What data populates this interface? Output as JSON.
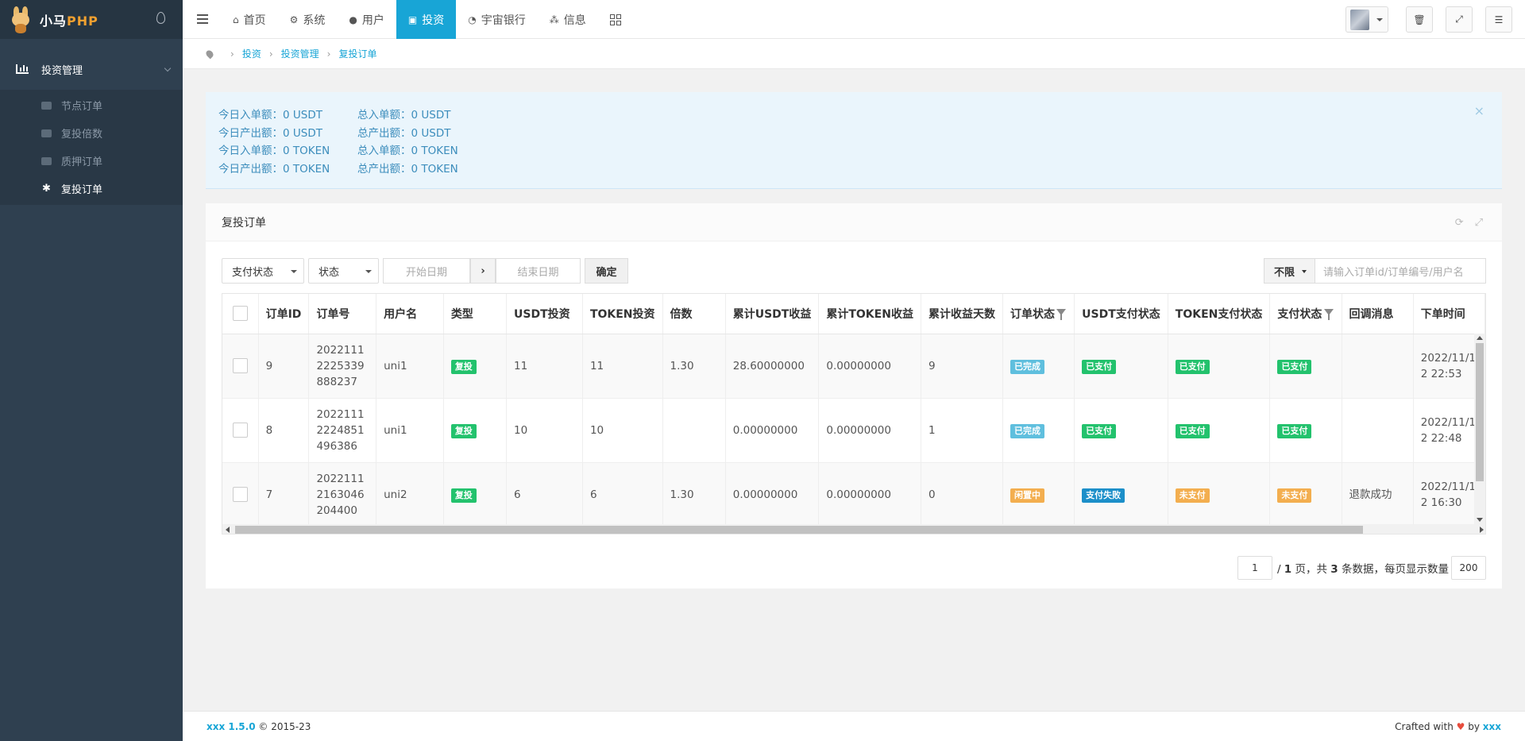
{
  "app": {
    "logo_cn": "小马",
    "logo_php": "PHP"
  },
  "sidebar": {
    "group_label": "投资管理",
    "items": [
      {
        "label": "节点订单",
        "icon": "cloud-icon"
      },
      {
        "label": "复投倍数",
        "icon": "file-icon"
      },
      {
        "label": "质押订单",
        "icon": "list-icon"
      },
      {
        "label": "复投订单",
        "icon": "asterisk-icon",
        "active": true
      }
    ]
  },
  "topnav": [
    {
      "label": "首页",
      "icon": "home-icon",
      "glyph": "⌂"
    },
    {
      "label": "系统",
      "icon": "gear-icon",
      "glyph": "⚙"
    },
    {
      "label": "用户",
      "icon": "user-icon",
      "glyph": "●"
    },
    {
      "label": "投资",
      "icon": "bag-icon",
      "glyph": "▣",
      "active": true
    },
    {
      "label": "宇宙银行",
      "icon": "dashboard-icon",
      "glyph": "◔"
    },
    {
      "label": "信息",
      "icon": "network-icon",
      "glyph": "⁂"
    }
  ],
  "breadcrumb": [
    "投资",
    "投资管理",
    "复投订单"
  ],
  "alert": {
    "rows": [
      [
        "今日入单额：0 USDT",
        "总入单额：0 USDT"
      ],
      [
        "今日产出额：0 USDT",
        "总产出额：0 USDT"
      ],
      [
        "今日入单额：0 TOKEN",
        "总入单额：0 TOKEN"
      ],
      [
        "今日产出额：0 TOKEN",
        "总产出额：0 TOKEN"
      ]
    ],
    "close": "×"
  },
  "panel": {
    "title": "复投订单",
    "toolbar": {
      "pay_status": "支付状态",
      "status": "状态",
      "start_date": "开始日期",
      "end_date": "结束日期",
      "arrow": "›",
      "confirm": "确定",
      "limit": "不限",
      "search_placeholder": "请输入订单id/订单编号/用户名"
    }
  },
  "table": {
    "columns": [
      "",
      "订单ID",
      "订单号",
      "用户名",
      "类型",
      "USDT投资",
      "TOKEN投资",
      "倍数",
      "累计USDT收益",
      "累计TOKEN收益",
      "累计收益天数",
      "订单状态",
      "USDT支付状态",
      "TOKEN支付状态",
      "支付状态",
      "回调消息",
      "下单时间"
    ],
    "rows": [
      {
        "id": "9",
        "order_no": "20221112225339888237",
        "user": "uni1",
        "type": "复投",
        "usdt": "11",
        "token": "11",
        "multiple": "1.30",
        "usdt_income": "28.60000000",
        "token_income": "0.00000000",
        "days": "9",
        "order_status": "已完成",
        "usdt_pay": "已支付",
        "token_pay": "已支付",
        "pay": "已支付",
        "callback": "",
        "time": "2022/11/12 22:53"
      },
      {
        "id": "8",
        "order_no": "20221112224851496386",
        "user": "uni1",
        "type": "复投",
        "usdt": "10",
        "token": "10",
        "multiple": "",
        "usdt_income": "0.00000000",
        "token_income": "0.00000000",
        "days": "1",
        "order_status": "已完成",
        "usdt_pay": "已支付",
        "token_pay": "已支付",
        "pay": "已支付",
        "callback": "",
        "time": "2022/11/12 22:48"
      },
      {
        "id": "7",
        "order_no": "20221112163046204400",
        "user": "uni2",
        "type": "复投",
        "usdt": "6",
        "token": "6",
        "multiple": "1.30",
        "usdt_income": "0.00000000",
        "token_income": "0.00000000",
        "days": "0",
        "order_status": "闲置中",
        "usdt_pay": "支付失败",
        "token_pay": "未支付",
        "pay": "未支付",
        "callback": "退款成功",
        "time": "2022/11/12 16:30"
      }
    ]
  },
  "pager": {
    "page": "1",
    "text_pre": "/ ",
    "total_pages": "1",
    "text_mid": " 页，共 ",
    "total": "3",
    "text_post": " 条数据，每页显示数量",
    "per_page": "200"
  },
  "footer": {
    "brand": "xxx 1.5.0",
    "copyright": " © 2015-23",
    "crafted": "Crafted with ",
    "heart": "♥",
    "by": " by ",
    "author": "xxx"
  },
  "colors": {
    "sidebar_bg": "#2f4050",
    "accent": "#18a5d6",
    "badge_green": "#23c26d",
    "badge_teal": "#5fbfde",
    "badge_orange": "#f3ae4f",
    "badge_blue": "#1c8fc9"
  }
}
